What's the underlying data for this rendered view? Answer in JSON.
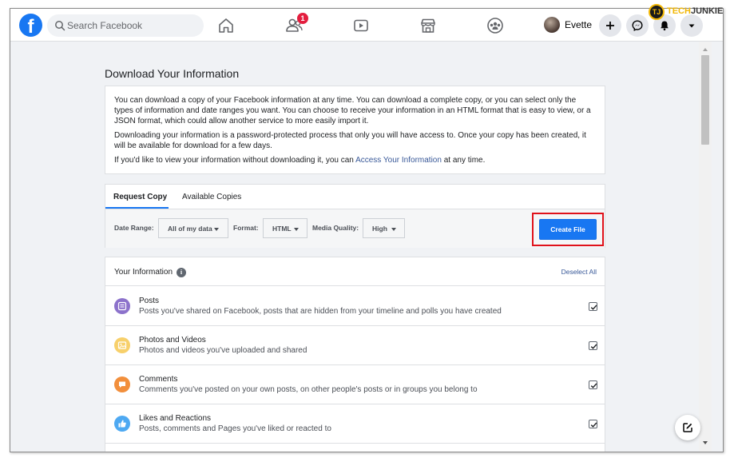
{
  "topbar": {
    "logo": "f",
    "search_placeholder": "Search Facebook",
    "friends_badge": "1",
    "profile_name": "Evette",
    "icons": [
      "home-icon",
      "friends-icon",
      "watch-icon",
      "marketplace-icon",
      "groups-icon",
      "plus-icon",
      "messenger-icon",
      "notifications-icon",
      "account-menu-icon"
    ]
  },
  "watermark": {
    "logo_letters": "TJ",
    "text_part1": "TECH",
    "text_part2": "JUNKIE"
  },
  "page": {
    "title": "Download Your Information",
    "intro": {
      "p1": "You can download a copy of your Facebook information at any time. You can download a complete copy, or you can select only the types of information and date ranges you want. You can choose to receive your information in an HTML format that is easy to view, or a JSON format, which could allow another service to more easily import it.",
      "p2": "Downloading your information is a password-protected process that only you will have access to. Once your copy has been created, it will be available for download for a few days.",
      "p3_before": "If you'd like to view your information without downloading it, you can ",
      "p3_link": "Access Your Information",
      "p3_after": " at any time."
    },
    "tabs": {
      "request_copy": "Request Copy",
      "available_copies": "Available Copies"
    },
    "filters": {
      "date_range_label": "Date Range:",
      "date_range_value": "All of my data",
      "format_label": "Format:",
      "format_value": "HTML",
      "quality_label": "Media Quality:",
      "quality_value": "High",
      "create_button": "Create File"
    },
    "your_information": {
      "title": "Your Information",
      "info_icon": "i",
      "deselect_all": "Deselect All",
      "items": [
        {
          "title": "Posts",
          "description": "Posts you've shared on Facebook, posts that are hidden from your timeline and polls you have created",
          "icon": "posts-icon",
          "color": "#8c72cb",
          "checked": true
        },
        {
          "title": "Photos and Videos",
          "description": "Photos and videos you've uploaded and shared",
          "icon": "photos-icon",
          "color": "#f7d06b",
          "checked": true
        },
        {
          "title": "Comments",
          "description": "Comments you've posted on your own posts, on other people's posts or in groups you belong to",
          "icon": "comments-icon",
          "color": "#f28f3c",
          "checked": true
        },
        {
          "title": "Likes and Reactions",
          "description": "Posts, comments and Pages you've liked or reacted to",
          "icon": "likes-icon",
          "color": "#4ea9f2",
          "checked": true
        }
      ]
    }
  },
  "colors": {
    "brand_blue": "#1877f2",
    "highlight_red": "#e0121b",
    "link": "#385898"
  }
}
